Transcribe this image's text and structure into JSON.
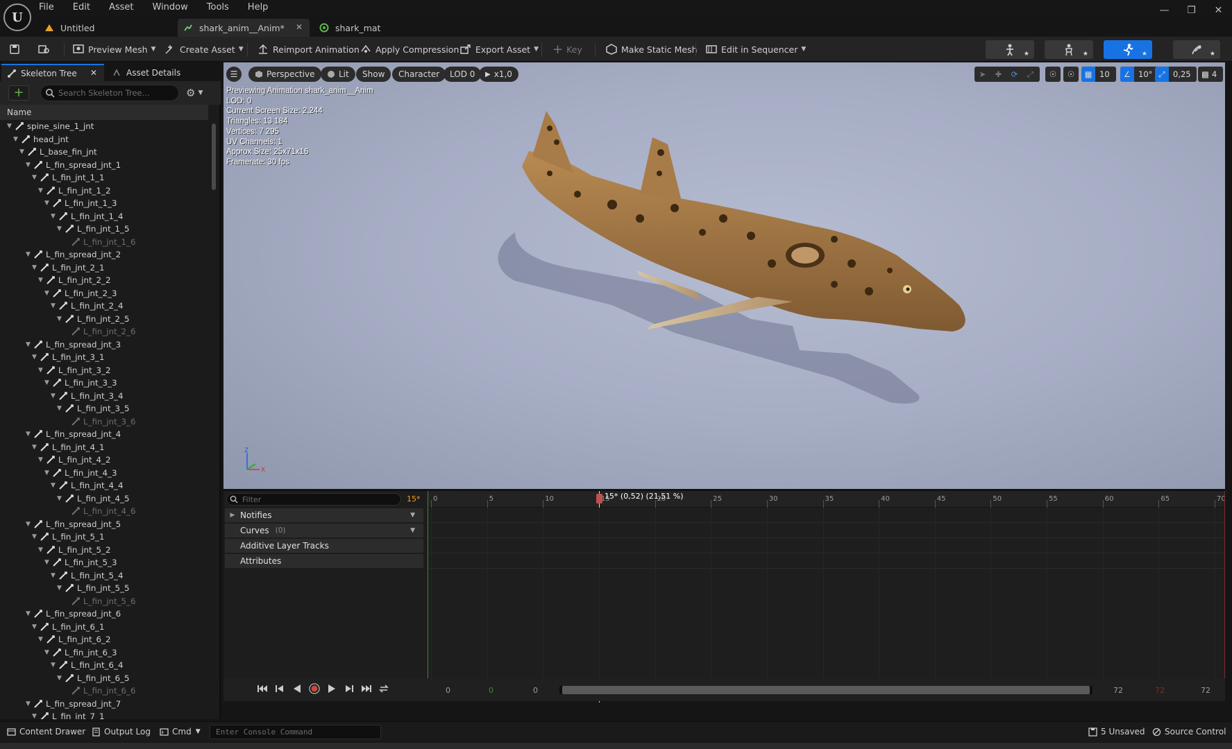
{
  "menu": [
    "File",
    "Edit",
    "Asset",
    "Window",
    "Tools",
    "Help"
  ],
  "tabs": [
    {
      "label": "Untitled"
    },
    {
      "label": "shark_anim__Anim*"
    },
    {
      "label": "shark_mat"
    }
  ],
  "toolbar": {
    "preview_mesh": "Preview Mesh",
    "create_asset": "Create Asset",
    "reimport": "Reimport Animation",
    "apply_compression": "Apply Compression",
    "export_asset": "Export Asset",
    "key": "Key",
    "make_static_mesh": "Make Static Mesh",
    "edit_in_sequencer": "Edit in Sequencer"
  },
  "left_panel": {
    "tab_skeleton": "Skeleton Tree",
    "tab_details": "Asset Details",
    "search_placeholder": "Search Skeleton Tree...",
    "column_header": "Name",
    "bones": [
      {
        "name": "spine_sine_1_jnt",
        "depth": 0,
        "ghost": false
      },
      {
        "name": "head_jnt",
        "depth": 1,
        "ghost": false
      },
      {
        "name": "L_base_fin_jnt",
        "depth": 2,
        "ghost": false
      },
      {
        "name": "L_fin_spread_jnt_1",
        "depth": 3,
        "ghost": false
      },
      {
        "name": "L_fin_jnt_1_1",
        "depth": 4,
        "ghost": false
      },
      {
        "name": "L_fin_jnt_1_2",
        "depth": 5,
        "ghost": false
      },
      {
        "name": "L_fin_jnt_1_3",
        "depth": 6,
        "ghost": false
      },
      {
        "name": "L_fin_jnt_1_4",
        "depth": 7,
        "ghost": false
      },
      {
        "name": "L_fin_jnt_1_5",
        "depth": 8,
        "ghost": false
      },
      {
        "name": "L_fin_jnt_1_6",
        "depth": 9,
        "ghost": true
      },
      {
        "name": "L_fin_spread_jnt_2",
        "depth": 3,
        "ghost": false
      },
      {
        "name": "L_fin_jnt_2_1",
        "depth": 4,
        "ghost": false
      },
      {
        "name": "L_fin_jnt_2_2",
        "depth": 5,
        "ghost": false
      },
      {
        "name": "L_fin_jnt_2_3",
        "depth": 6,
        "ghost": false
      },
      {
        "name": "L_fin_jnt_2_4",
        "depth": 7,
        "ghost": false
      },
      {
        "name": "L_fin_jnt_2_5",
        "depth": 8,
        "ghost": false
      },
      {
        "name": "L_fin_jnt_2_6",
        "depth": 9,
        "ghost": true
      },
      {
        "name": "L_fin_spread_jnt_3",
        "depth": 3,
        "ghost": false
      },
      {
        "name": "L_fin_jnt_3_1",
        "depth": 4,
        "ghost": false
      },
      {
        "name": "L_fin_jnt_3_2",
        "depth": 5,
        "ghost": false
      },
      {
        "name": "L_fin_jnt_3_3",
        "depth": 6,
        "ghost": false
      },
      {
        "name": "L_fin_jnt_3_4",
        "depth": 7,
        "ghost": false
      },
      {
        "name": "L_fin_jnt_3_5",
        "depth": 8,
        "ghost": false
      },
      {
        "name": "L_fin_jnt_3_6",
        "depth": 9,
        "ghost": true
      },
      {
        "name": "L_fin_spread_jnt_4",
        "depth": 3,
        "ghost": false
      },
      {
        "name": "L_fin_jnt_4_1",
        "depth": 4,
        "ghost": false
      },
      {
        "name": "L_fin_jnt_4_2",
        "depth": 5,
        "ghost": false
      },
      {
        "name": "L_fin_jnt_4_3",
        "depth": 6,
        "ghost": false
      },
      {
        "name": "L_fin_jnt_4_4",
        "depth": 7,
        "ghost": false
      },
      {
        "name": "L_fin_jnt_4_5",
        "depth": 8,
        "ghost": false
      },
      {
        "name": "L_fin_jnt_4_6",
        "depth": 9,
        "ghost": true
      },
      {
        "name": "L_fin_spread_jnt_5",
        "depth": 3,
        "ghost": false
      },
      {
        "name": "L_fin_jnt_5_1",
        "depth": 4,
        "ghost": false
      },
      {
        "name": "L_fin_jnt_5_2",
        "depth": 5,
        "ghost": false
      },
      {
        "name": "L_fin_jnt_5_3",
        "depth": 6,
        "ghost": false
      },
      {
        "name": "L_fin_jnt_5_4",
        "depth": 7,
        "ghost": false
      },
      {
        "name": "L_fin_jnt_5_5",
        "depth": 8,
        "ghost": false
      },
      {
        "name": "L_fin_jnt_5_6",
        "depth": 9,
        "ghost": true
      },
      {
        "name": "L_fin_spread_jnt_6",
        "depth": 3,
        "ghost": false
      },
      {
        "name": "L_fin_jnt_6_1",
        "depth": 4,
        "ghost": false
      },
      {
        "name": "L_fin_jnt_6_2",
        "depth": 5,
        "ghost": false
      },
      {
        "name": "L_fin_jnt_6_3",
        "depth": 6,
        "ghost": false
      },
      {
        "name": "L_fin_jnt_6_4",
        "depth": 7,
        "ghost": false
      },
      {
        "name": "L_fin_jnt_6_5",
        "depth": 8,
        "ghost": false
      },
      {
        "name": "L_fin_jnt_6_6",
        "depth": 9,
        "ghost": true
      },
      {
        "name": "L_fin_spread_jnt_7",
        "depth": 3,
        "ghost": false
      },
      {
        "name": "L_fin_jnt_7_1",
        "depth": 4,
        "ghost": false
      }
    ]
  },
  "viewport": {
    "perspective": "Perspective",
    "lit": "Lit",
    "show": "Show",
    "character": "Character",
    "lod": "LOD 0",
    "play_rate": "x1,0",
    "grid_snap": "10",
    "rot_snap": "10°",
    "scale_snap": "0,25",
    "camera_speed": "4",
    "stats": [
      "Previewing Animation shark_anim__Anim",
      "LOD: 0",
      "Current Screen Size: 2,244",
      "Triangles: 13 184",
      "Vertices: 7 295",
      "UV Channels: 1",
      "Approx Size: 25x71x16",
      "Framerate: 30 fps"
    ],
    "axis_z": "Z",
    "axis_x": "X"
  },
  "timeline": {
    "filter_placeholder": "Filter",
    "current_frame": "15*",
    "playhead_label": "15* (0,52) (21,51 %)",
    "playhead_frame": 15,
    "ruler_max_frame": 70,
    "tick_labels": [
      "0",
      "5",
      "10",
      "15",
      "20",
      "25",
      "30",
      "35",
      "40",
      "45",
      "50",
      "55",
      "60",
      "65",
      "70"
    ],
    "tracks": [
      {
        "label": "Notifies",
        "count": "",
        "expandable": true,
        "dropdown": true
      },
      {
        "label": "Curves",
        "count": "(0)",
        "expandable": false,
        "dropdown": true
      },
      {
        "label": "Additive Layer Tracks",
        "count": "",
        "expandable": false,
        "dropdown": false
      },
      {
        "label": "Attributes",
        "count": "",
        "expandable": false,
        "dropdown": false
      }
    ],
    "range_start_a": "0",
    "range_start_b": "0",
    "range_start_c": "0",
    "range_end_a": "72",
    "range_end_b": "72",
    "range_end_c": "72"
  },
  "statusbar": {
    "content_drawer": "Content Drawer",
    "output_log": "Output Log",
    "cmd": "Cmd",
    "console_placeholder": "Enter Console Command",
    "unsaved": "5 Unsaved",
    "source_control": "Source Control"
  },
  "colors": {
    "accent": "#1773e4",
    "viewport_bg": "#a6adc4",
    "panel_bg": "#1b1b1b",
    "playhead_marker": "#c0504c"
  }
}
